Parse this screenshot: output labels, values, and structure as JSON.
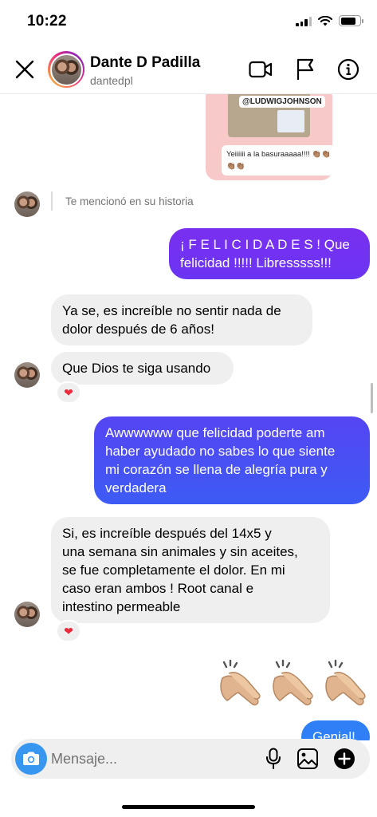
{
  "status_bar": {
    "time": "10:22"
  },
  "header": {
    "name": "Dante D Padilla",
    "username": "dantedpl"
  },
  "story": {
    "tag": "@LUDWIGJOHNSON",
    "caption": "Yeiiiiii a la basuraaaaa!!!! 👏🏽👏🏽👏🏽👏🏽"
  },
  "mention": {
    "text": "Te mencionó en su historia"
  },
  "messages": [
    {
      "from": "me",
      "text": "¡ F E L I C I D A D E S ! Que\nfelicidad !!!!! Libresssss!!!"
    },
    {
      "from": "them",
      "text": "Ya se, es increíble no sentir nada de\ndolor después de 6 años!"
    },
    {
      "from": "them",
      "text": "Que Dios te siga usando",
      "reaction": "❤"
    },
    {
      "from": "me",
      "text": "Awwwwww que felicidad poderte am\nhaber ayudado no sabes lo que siente\nmi corazón se llena de alegría pura y\nverdadera"
    },
    {
      "from": "them",
      "text": "Si, es increíble después del 14x5 y\nuna semana sin animales y sin aceites,\nse fue completamente el dolor. En mi\ncaso eran ambos ! Root canal e\nintestino permeable",
      "reaction": "❤"
    },
    {
      "from": "me",
      "text": "Genial!"
    }
  ],
  "emoji_message": {
    "name": "clapping-hands",
    "count": 3
  },
  "composer": {
    "placeholder": "Mensaje..."
  },
  "colors": {
    "outgoing_top": "#7a2ff0",
    "outgoing_bottom": "#3d5bf5",
    "incoming": "#efefef",
    "camera": "#3797f0",
    "heart": "#ed2b3c"
  }
}
